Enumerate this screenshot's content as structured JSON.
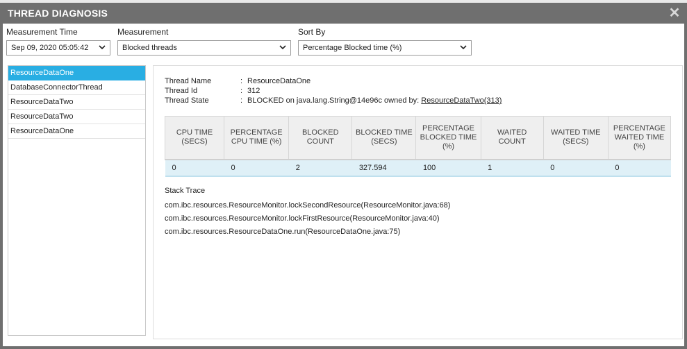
{
  "dialog": {
    "title": "THREAD DIAGNOSIS",
    "close_glyph": "✕"
  },
  "filters": {
    "measurement_time": {
      "label": "Measurement Time",
      "value": "Sep 09, 2020 05:05:42"
    },
    "measurement": {
      "label": "Measurement",
      "value": "Blocked threads"
    },
    "sort_by": {
      "label": "Sort By",
      "value": "Percentage Blocked time (%)"
    }
  },
  "threads": [
    {
      "label": "ResourceDataOne",
      "selected": true
    },
    {
      "label": "DatabaseConnectorThread",
      "selected": false
    },
    {
      "label": "ResourceDataTwo",
      "selected": false
    },
    {
      "label": "ResourceDataTwo",
      "selected": false
    },
    {
      "label": "ResourceDataOne",
      "selected": false
    }
  ],
  "details": {
    "thread_name_label": "Thread Name",
    "thread_name": "ResourceDataOne",
    "thread_id_label": "Thread Id",
    "thread_id": "312",
    "thread_state_label": "Thread State",
    "thread_state_prefix": "BLOCKED on java.lang.String@14e96c owned by: ",
    "owner_name": "ResourceDataTwo",
    "owner_id": "(313)",
    "separator": ":"
  },
  "metrics": {
    "headers": [
      "CPU TIME (SECS)",
      "PERCENTAGE CPU TIME (%)",
      "BLOCKED COUNT",
      "BLOCKED TIME (SECS)",
      "PERCENTAGE BLOCKED TIME (%)",
      "WAITED COUNT",
      "WAITED TIME (SECS)",
      "PERCENTAGE WAITED TIME (%)"
    ],
    "row": [
      "0",
      "0",
      "2",
      "327.594",
      "100",
      "1",
      "0",
      "0"
    ]
  },
  "stack_trace": {
    "title": "Stack Trace",
    "lines": [
      "com.ibc.resources.ResourceMonitor.lockSecondResource(ResourceMonitor.java:68)",
      "com.ibc.resources.ResourceMonitor.lockFirstResource(ResourceMonitor.java:40)",
      "com.ibc.resources.ResourceDataOne.run(ResourceDataOne.java:75)"
    ]
  },
  "colors": {
    "titlebar": "#6f6f6f",
    "selected": "#29aee3",
    "row_highlight": "#dff0f7"
  }
}
